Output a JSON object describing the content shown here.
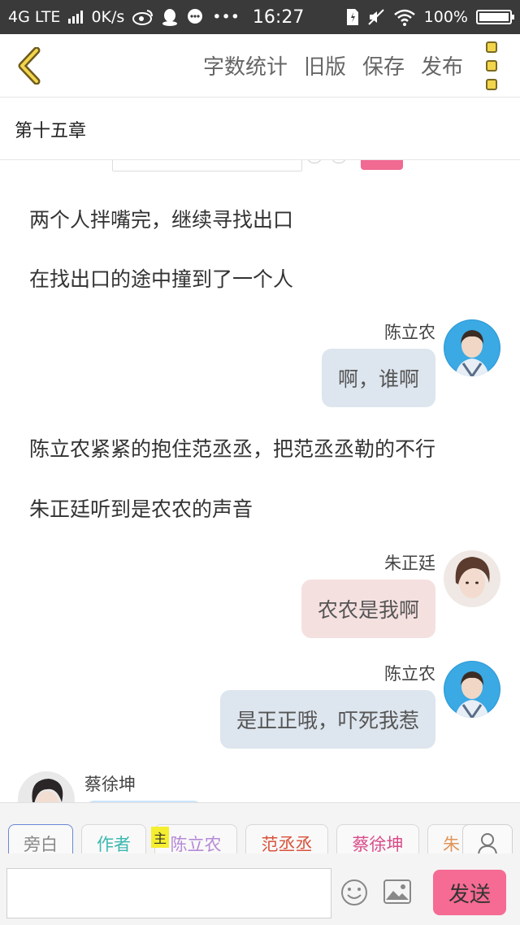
{
  "status_bar": {
    "network": "4G LTE",
    "speed": "0K/s",
    "time": "16:27",
    "battery": "100%",
    "icons": [
      "signal-icon",
      "weibo-icon",
      "qq-icon",
      "chat-icon",
      "more-dots-icon",
      "sim-icon",
      "mute-icon",
      "wifi-icon",
      "battery-icon"
    ]
  },
  "toolbar": {
    "back_icon": "chevron-left-icon",
    "actions": [
      "字数统计",
      "旧版",
      "保存",
      "发布"
    ],
    "more_icon": "three-square-menu-icon"
  },
  "chapter": {
    "title": "第十五章"
  },
  "story": {
    "narration_1": "两个人拌嘴完，继续寻找出口",
    "narration_2": "在找出口的途中撞到了一个人",
    "msg_1": {
      "name": "陈立农",
      "text": "啊，谁啊"
    },
    "narration_3": "陈立农紧紧的抱住范丞丞，把范丞丞勒的不行",
    "narration_4": "朱正廷听到是农农的声音",
    "msg_2": {
      "name": "朱正廷",
      "text": "农农是我啊"
    },
    "msg_3": {
      "name": "陈立农",
      "text": "是正正哦，吓死我惹"
    },
    "msg_4": {
      "name": "蔡徐坤"
    }
  },
  "composer": {
    "roles": [
      {
        "label": "旁白",
        "color": "#888888"
      },
      {
        "label": "作者",
        "color": "#3bb8b0"
      },
      {
        "label": "陈立农",
        "color": "#b58ad6"
      },
      {
        "label": "范丞丞",
        "color": "#d9533b"
      },
      {
        "label": "蔡徐坤",
        "color": "#d94c8a"
      },
      {
        "label": "朱",
        "color": "#e0955a"
      }
    ],
    "host_tag": "主",
    "input_value": "",
    "send_label": "发送",
    "colors": {
      "send_bg": "#f56b93"
    }
  }
}
